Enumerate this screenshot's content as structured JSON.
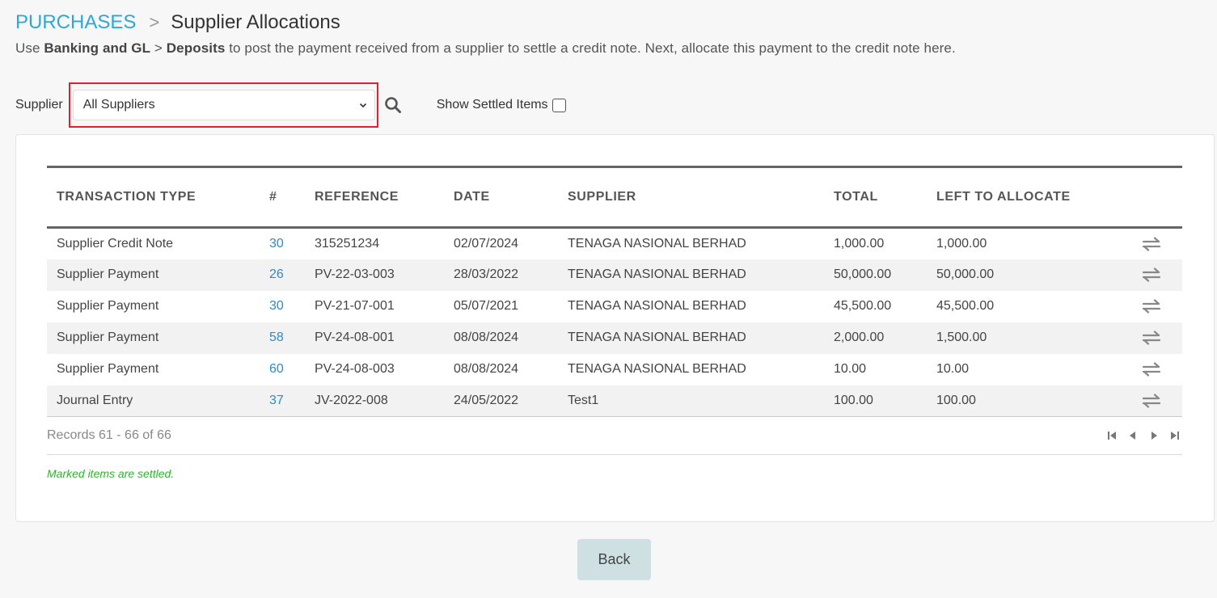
{
  "breadcrumb": {
    "section": "PURCHASES",
    "separator": ">",
    "title": "Supplier Allocations"
  },
  "description": {
    "prefix": "Use ",
    "bold1": "Banking and GL",
    "mid": " > ",
    "bold2": "Deposits",
    "suffix": " to post the payment received from a supplier to settle a credit note. Next, allocate this payment to the credit note here."
  },
  "filter": {
    "supplier_label": "Supplier",
    "supplier_selected": "All Suppliers",
    "show_settled_label": "Show Settled Items",
    "show_settled_checked": false
  },
  "table": {
    "headers": [
      "TRANSACTION TYPE",
      "#",
      "REFERENCE",
      "DATE",
      "SUPPLIER",
      "TOTAL",
      "LEFT TO ALLOCATE"
    ],
    "rows": [
      {
        "type": "Supplier Credit Note",
        "num": "30",
        "reference": "315251234",
        "date": "02/07/2024",
        "supplier": "TENAGA NASIONAL BERHAD",
        "total": "1,000.00",
        "left": "1,000.00"
      },
      {
        "type": "Supplier Payment",
        "num": "26",
        "reference": "PV-22-03-003",
        "date": "28/03/2022",
        "supplier": "TENAGA NASIONAL BERHAD",
        "total": "50,000.00",
        "left": "50,000.00"
      },
      {
        "type": "Supplier Payment",
        "num": "30",
        "reference": "PV-21-07-001",
        "date": "05/07/2021",
        "supplier": "TENAGA NASIONAL BERHAD",
        "total": "45,500.00",
        "left": "45,500.00"
      },
      {
        "type": "Supplier Payment",
        "num": "58",
        "reference": "PV-24-08-001",
        "date": "08/08/2024",
        "supplier": "TENAGA NASIONAL BERHAD",
        "total": "2,000.00",
        "left": "1,500.00"
      },
      {
        "type": "Supplier Payment",
        "num": "60",
        "reference": "PV-24-08-003",
        "date": "08/08/2024",
        "supplier": "TENAGA NASIONAL BERHAD",
        "total": "10.00",
        "left": "10.00"
      },
      {
        "type": "Journal Entry",
        "num": "37",
        "reference": "JV-2022-008",
        "date": "24/05/2022",
        "supplier": "Test1",
        "total": "100.00",
        "left": "100.00"
      }
    ],
    "row_action_icon": "allocate-arrows-icon"
  },
  "pagination": {
    "records_text": "Records 61 - 66 of 66",
    "icons": [
      "first-page-icon",
      "prev-page-icon",
      "next-page-icon",
      "last-page-icon"
    ]
  },
  "note": "Marked items are settled.",
  "back_label": "Back",
  "colors": {
    "link": "#2ea7d6",
    "highlight": "#e02030",
    "note": "#2db52d",
    "back_button": "#cfe0e3"
  }
}
